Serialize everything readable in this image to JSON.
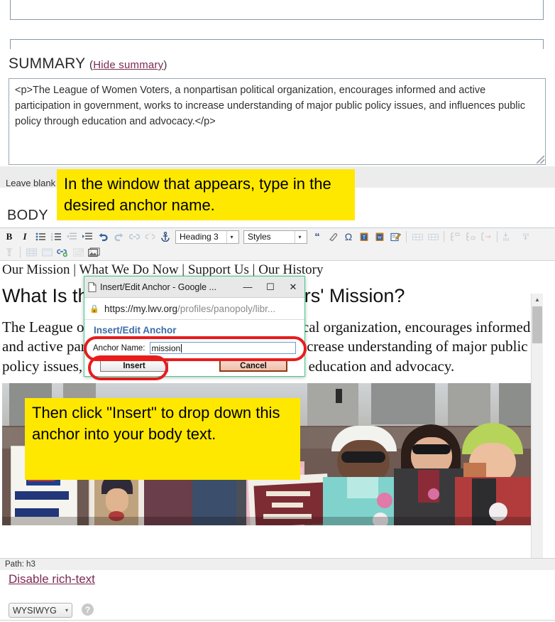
{
  "summary": {
    "heading": "SUMMARY",
    "paren_open": "(",
    "toggle_link": "Hide summary",
    "paren_close": ")",
    "textarea_value": "<p>The League of Women Voters, a nonpartisan political organization, encourages informed and active participation in government, works to increase understanding of major public policy issues, and influences public policy through education and advocacy.</p>"
  },
  "leave_blank_hint": "Leave blank",
  "body_section": {
    "label": "BODY",
    "path_bar": "Path: h3",
    "disable_rich_text": "Disable rich-text",
    "format_select": "WYSIWYG",
    "help_icon": "question-mark-icon"
  },
  "toolbar": {
    "row1": [
      {
        "name": "bold-button",
        "glyph": "B",
        "dim": false
      },
      {
        "name": "italic-button",
        "glyph": "I",
        "dim": false
      },
      {
        "name": "bulleted-list-button",
        "glyph": "list-ul-icon",
        "dim": false
      },
      {
        "name": "numbered-list-button",
        "glyph": "list-ol-icon",
        "dim": false
      },
      {
        "name": "outdent-button",
        "glyph": "outdent-icon",
        "dim": true
      },
      {
        "name": "indent-button",
        "glyph": "indent-icon",
        "dim": false
      },
      {
        "name": "undo-button",
        "glyph": "undo-icon",
        "dim": false
      },
      {
        "name": "redo-button",
        "glyph": "redo-icon",
        "dim": true
      },
      {
        "name": "link-button",
        "glyph": "link-icon",
        "dim": true
      },
      {
        "name": "unlink-button",
        "glyph": "unlink-icon",
        "dim": true
      },
      {
        "name": "anchor-button",
        "glyph": "anchor-icon",
        "dim": false
      }
    ],
    "format_select": "Heading 3",
    "styles_select": "Styles",
    "row1b": [
      {
        "name": "blockquote-button",
        "glyph": "quote-icon",
        "dim": false
      },
      {
        "name": "remove-format-button",
        "glyph": "eraser-icon",
        "dim": false
      },
      {
        "name": "special-character-button",
        "glyph": "omega-icon",
        "dim": false
      },
      {
        "name": "paste-as-text-button",
        "glyph": "paste-text-icon",
        "dim": false
      },
      {
        "name": "paste-from-word-button",
        "glyph": "paste-word-icon",
        "dim": false
      },
      {
        "name": "edit-source-button",
        "glyph": "edit-pencil-icon",
        "dim": false
      },
      {
        "name": "insert-row-button",
        "glyph": "table-row-icon",
        "dim": true
      },
      {
        "name": "insert-column-button",
        "glyph": "table-col-icon",
        "dim": true
      },
      {
        "name": "cell-properties-button",
        "glyph": "cell-prop-icon",
        "dim": true
      },
      {
        "name": "merge-cells-button",
        "glyph": "merge-cells-icon",
        "dim": true
      },
      {
        "name": "split-cells-button",
        "glyph": "split-cells-icon",
        "dim": true
      },
      {
        "name": "row-top-button",
        "glyph": "row-top-icon",
        "dim": true
      },
      {
        "name": "row-bottom-button",
        "glyph": "row-bottom-icon",
        "dim": true
      }
    ],
    "row2": [
      {
        "name": "insert-anchor-marker-button",
        "glyph": "anchor-marker-icon",
        "dim": true
      },
      {
        "name": "insert-table-button",
        "glyph": "table-icon",
        "dim": true
      },
      {
        "name": "table-properties-button",
        "glyph": "table-props-icon",
        "dim": true
      },
      {
        "name": "insert-link-button",
        "glyph": "link-add-icon",
        "dim": false
      },
      {
        "name": "insert-template-button",
        "glyph": "template-icon",
        "dim": true
      },
      {
        "name": "insert-image-button",
        "glyph": "image-icon",
        "dim": false
      }
    ]
  },
  "document": {
    "nav_line": "Our Mission | What We Do Now | Support Us | Our History",
    "heading": "What Is the League of Women Voters' Mission?",
    "paragraph": "The League of Women Voters, a nonpartisan political organization, encourages informed and active participation in government, works to increase understanding of major public policy issues, and influences public policy through education and advocacy.",
    "image_alt": "LWVUS members marching with signs"
  },
  "dialog": {
    "window_title": "Insert/Edit Anchor - Google ...",
    "minimize_glyph": "minimize-icon",
    "maximize_glyph": "maximize-icon",
    "close_glyph": "close-icon",
    "url_domain": "https://my.lwv.org",
    "url_path": "/profiles/panopoly/libr...",
    "form_heading": "Insert/Edit Anchor",
    "field_label": "Anchor Name:",
    "field_value": "mission",
    "insert_label": "Insert",
    "cancel_label": "Cancel"
  },
  "callouts": [
    {
      "text": "In the window that appears, type in the desired anchor name."
    },
    {
      "text": "Then click \"Insert\" to drop down this anchor into your body text."
    }
  ],
  "colors": {
    "callout_bg": "#ffe800",
    "highlight_ring": "#e81c1c",
    "link": "#7b2a53",
    "dialog_border": "#3ecf8e",
    "dialog_heading": "#3c6ca8"
  }
}
